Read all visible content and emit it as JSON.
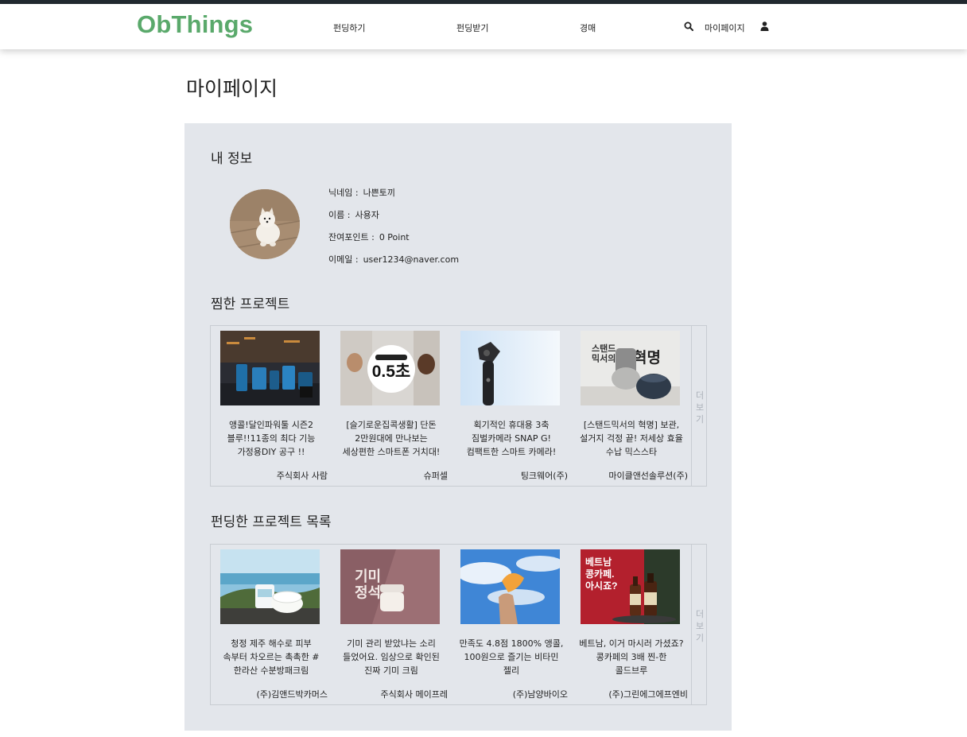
{
  "header": {
    "logo": "ObThings",
    "nav": [
      "펀딩하기",
      "펀딩받기",
      "경매"
    ],
    "mypage_label": "마이페이지"
  },
  "page": {
    "title": "마이페이지"
  },
  "profile": {
    "section_title": "내 정보",
    "nickname_label": "닉네임 :",
    "nickname": "나쁜토끼",
    "name_label": "이름 :",
    "name": "사용자",
    "points_label": "잔여포인트 :",
    "points": "0 Point",
    "email_label": "이메일 :",
    "email": "user1234@naver.com"
  },
  "liked": {
    "section_title": "찜한 프로젝트",
    "more_label": "더보기",
    "items": [
      {
        "title": "앵콜!달인파워툴 시즌2 블루!!11종의 최다 기능 가정용DIY 공구 !!",
        "company": "주식회사 사람"
      },
      {
        "title": "[슬기로운집콕생활] 단돈 2만원대에 만나보는 세상편한 스마트폰 거치대!",
        "company": "슈퍼셀",
        "thumb_text": "0.5초"
      },
      {
        "title": "획기적인 휴대용 3축 짐벌카메라 SNAP G! 컴팩트한 스마트 카메라!",
        "company": "팅크웨어(주)"
      },
      {
        "title": "[스탠드믹서의 혁명] 보관, 설거지 걱정 끝! 저세상 효율 수납 믹스스타",
        "company": "마이클앤선솔루션(주)",
        "thumb_text_a": "스탠드\n믹서의",
        "thumb_text_b": "혁명"
      }
    ]
  },
  "funded": {
    "section_title": "펀딩한 프로젝트 목록",
    "more_label": "더보기",
    "items": [
      {
        "title": "청정 제주 해수로 피부 속부터 차오르는 촉촉한 #한라산 수분방패크림",
        "company": "(주)김앤드박카머스"
      },
      {
        "title": "기미 관리 받았냐는 소리 들었어요. 임상으로 확인된 진짜 기미 크림",
        "company": "주식회사 메이프레",
        "thumb_text": "기미\n정석"
      },
      {
        "title": "만족도 4.8점 1800% 앵콜, 100원으로 즐기는 비타민 젤리",
        "company": "(주)남양바이오"
      },
      {
        "title": "베트남, 이거 마시러 가셨죠? 콩카페의 3배 찐-한 콜드브루",
        "company": "(주)그린에그에프엔비",
        "thumb_text": "베트남\n콩카페.\n아시죠?"
      }
    ]
  },
  "colors": {
    "brand": "#5aa96b",
    "panel": "#e3e6eb",
    "topstrip": "#222a30"
  }
}
